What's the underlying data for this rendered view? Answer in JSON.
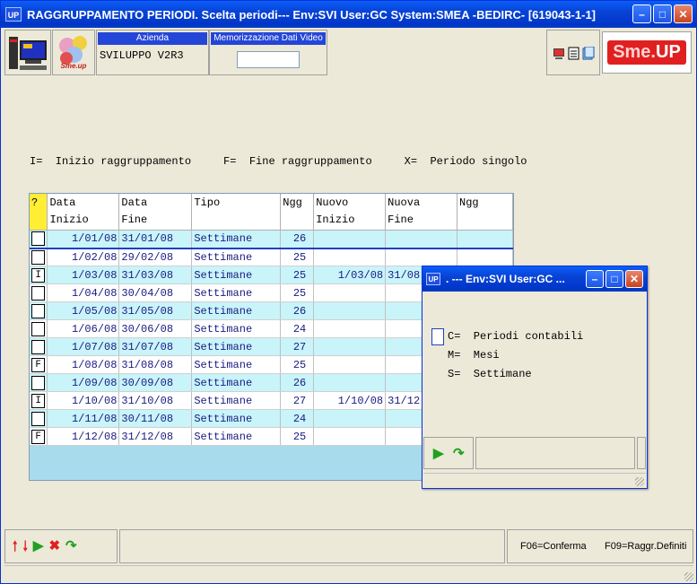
{
  "window": {
    "app_icon": "UP",
    "title": "RAGGRUPPAMENTO PERIODI.  Scelta periodi--- Env:SVI User:GC System:SMEA -BEDIRC- [619043-1-1]"
  },
  "toolbar": {
    "azienda_label": "Azienda",
    "azienda_value": "SVILUPPO V2R3",
    "memo_label": "Memorizzazione Dati Video",
    "memo_value": "",
    "logo_text_a": "Sme.",
    "logo_text_b": "UP",
    "smeup_icon_caption": "Sme.up"
  },
  "legend": "I=  Inizio raggruppamento     F=  Fine raggruppamento     X=  Periodo singolo",
  "grid": {
    "headers": [
      {
        "l1": "?",
        "l2": ""
      },
      {
        "l1": "Data",
        "l2": "Inizio"
      },
      {
        "l1": "Data",
        "l2": "Fine"
      },
      {
        "l1": "Tipo",
        "l2": ""
      },
      {
        "l1": "Ngg",
        "l2": ""
      },
      {
        "l1": "Nuovo",
        "l2": "Inizio"
      },
      {
        "l1": "Nuova",
        "l2": "Fine"
      },
      {
        "l1": "Ngg",
        "l2": ""
      }
    ],
    "rows": [
      {
        "flag": "",
        "inizio": "1/01/08",
        "fine": "31/01/08",
        "tipo": "Settimane",
        "ngg": "26",
        "n_inizio": "",
        "n_fine": "",
        "n_ngg": ""
      },
      {
        "flag": "",
        "inizio": "1/02/08",
        "fine": "29/02/08",
        "tipo": "Settimane",
        "ngg": "25",
        "n_inizio": "",
        "n_fine": "",
        "n_ngg": ""
      },
      {
        "flag": "I",
        "inizio": "1/03/08",
        "fine": "31/03/08",
        "tipo": "Settimane",
        "ngg": "25",
        "n_inizio": "1/03/08",
        "n_fine": "31/08",
        "n_ngg": ""
      },
      {
        "flag": "",
        "inizio": "1/04/08",
        "fine": "30/04/08",
        "tipo": "Settimane",
        "ngg": "25",
        "n_inizio": "",
        "n_fine": "",
        "n_ngg": ""
      },
      {
        "flag": "",
        "inizio": "1/05/08",
        "fine": "31/05/08",
        "tipo": "Settimane",
        "ngg": "26",
        "n_inizio": "",
        "n_fine": "",
        "n_ngg": ""
      },
      {
        "flag": "",
        "inizio": "1/06/08",
        "fine": "30/06/08",
        "tipo": "Settimane",
        "ngg": "24",
        "n_inizio": "",
        "n_fine": "",
        "n_ngg": ""
      },
      {
        "flag": "",
        "inizio": "1/07/08",
        "fine": "31/07/08",
        "tipo": "Settimane",
        "ngg": "27",
        "n_inizio": "",
        "n_fine": "",
        "n_ngg": ""
      },
      {
        "flag": "F",
        "inizio": "1/08/08",
        "fine": "31/08/08",
        "tipo": "Settimane",
        "ngg": "25",
        "n_inizio": "",
        "n_fine": "",
        "n_ngg": ""
      },
      {
        "flag": "",
        "inizio": "1/09/08",
        "fine": "30/09/08",
        "tipo": "Settimane",
        "ngg": "26",
        "n_inizio": "",
        "n_fine": "",
        "n_ngg": ""
      },
      {
        "flag": "I",
        "inizio": "1/10/08",
        "fine": "31/10/08",
        "tipo": "Settimane",
        "ngg": "27",
        "n_inizio": "1/10/08",
        "n_fine": "31/12",
        "n_ngg": ""
      },
      {
        "flag": "",
        "inizio": "1/11/08",
        "fine": "30/11/08",
        "tipo": "Settimane",
        "ngg": "24",
        "n_inizio": "",
        "n_fine": "",
        "n_ngg": ""
      },
      {
        "flag": "F",
        "inizio": "1/12/08",
        "fine": "31/12/08",
        "tipo": "Settimane",
        "ngg": "25",
        "n_inizio": "",
        "n_fine": "",
        "n_ngg": ""
      }
    ]
  },
  "bottom": {
    "icons": [
      "arrow-up-icon",
      "arrow-down-icon",
      "play-icon",
      "cancel-icon",
      "back-icon"
    ],
    "f06": "F06=Conferma",
    "f09": "F09=Raggr.Definiti"
  },
  "dialog": {
    "app_icon": "UP",
    "title": ". --- Env:SVI User:GC ...",
    "options": [
      {
        "text": "C=  Periodi contabili",
        "has_input": true
      },
      {
        "text": "M=  Mesi",
        "has_input": false
      },
      {
        "text": "S=  Settimane",
        "has_input": false
      }
    ]
  },
  "colors": {
    "title_blue": "#0843d6",
    "row_alt": "#c8f4fa",
    "grid_bg": "#a8dcec",
    "header_flag": "#ffee33",
    "logo_red": "#e02020"
  }
}
